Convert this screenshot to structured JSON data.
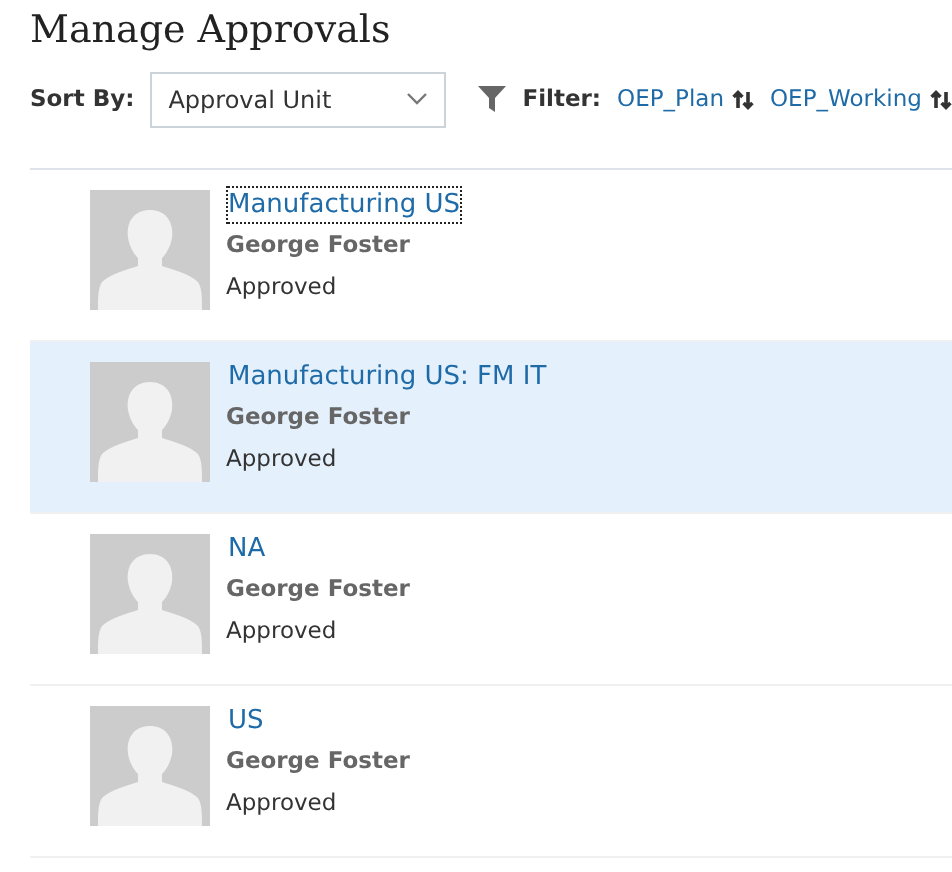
{
  "title": "Manage Approvals",
  "sort": {
    "label": "Sort By:",
    "value": "Approval Unit"
  },
  "filter": {
    "label": "Filter:",
    "links": [
      "OEP_Plan",
      "OEP_Working"
    ]
  },
  "items": [
    {
      "unit": "Manufacturing US",
      "owner": "George Foster",
      "status": "Approved",
      "selected": false,
      "focused": true
    },
    {
      "unit": "Manufacturing US: FM IT",
      "owner": "George Foster",
      "status": "Approved",
      "selected": true,
      "focused": false
    },
    {
      "unit": "NA",
      "owner": "George Foster",
      "status": "Approved",
      "selected": false,
      "focused": false
    },
    {
      "unit": "US",
      "owner": "George Foster",
      "status": "Approved",
      "selected": false,
      "focused": false
    }
  ]
}
